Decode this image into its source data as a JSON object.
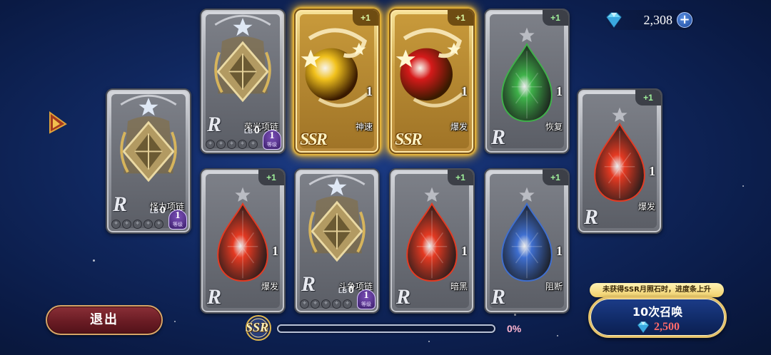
{
  "currency": {
    "amount": "2,308",
    "plus": "+"
  },
  "cards": [
    {
      "id": "c1",
      "kind": "necklace",
      "rarity": "R",
      "name": "怪力项链",
      "lb_label": "LB",
      "lb": "0",
      "level": "1",
      "level_label": "等级",
      "stars": [
        "✦",
        "✦",
        "✦",
        "✦",
        "✦"
      ]
    },
    {
      "id": "c2",
      "kind": "necklace",
      "rarity": "R",
      "name": "荣光项链",
      "lb_label": "LB",
      "lb": "0",
      "level": "1",
      "level_label": "等级",
      "stars": [
        "✦",
        "✦",
        "✦",
        "✦",
        "✦"
      ]
    },
    {
      "id": "c3",
      "kind": "orb",
      "rarity": "SSR",
      "plus": "+1",
      "count": "1",
      "name": "神速",
      "color": "#f2c21d"
    },
    {
      "id": "c4",
      "kind": "orb",
      "rarity": "SSR",
      "plus": "+1",
      "count": "1",
      "name": "爆发",
      "color": "#d61a1a"
    },
    {
      "id": "c5",
      "kind": "gem",
      "rarity": "R",
      "plus": "+1",
      "count": "1",
      "name": "恢复",
      "color": "#3fb24a"
    },
    {
      "id": "c6",
      "kind": "gem",
      "rarity": "R",
      "plus": "+1",
      "count": "1",
      "name": "爆发",
      "color": "#e53a22"
    },
    {
      "id": "c7",
      "kind": "gem",
      "rarity": "R",
      "plus": "+1",
      "count": "1",
      "name": "爆发",
      "color": "#e53a22"
    },
    {
      "id": "c8",
      "kind": "necklace",
      "rarity": "R",
      "name": "斗争项链",
      "lb_label": "LB",
      "lb": "0",
      "level": "1",
      "level_label": "等级",
      "stars": [
        "✦",
        "✦",
        "✦",
        "✦",
        "✦"
      ]
    },
    {
      "id": "c9",
      "kind": "gem",
      "rarity": "R",
      "plus": "+1",
      "count": "1",
      "name": "暗黑",
      "color": "#e53a22"
    },
    {
      "id": "c10",
      "kind": "gem",
      "rarity": "R",
      "plus": "+1",
      "count": "1",
      "name": "阻断",
      "color": "#3f6fd0"
    }
  ],
  "exit_label": "退出",
  "progress": {
    "badge": "SSR",
    "percent": "0%",
    "value": 0
  },
  "summon": {
    "note": "未获得SSR月照石时，进度条上升",
    "label": "10次召唤",
    "cost": "2,500"
  },
  "colors": {
    "gem_icon": "#5ec8f0",
    "ssr_glow": "#ffcf4d",
    "exit_border": "#d8a567",
    "summon_border": "#e7c46b"
  }
}
